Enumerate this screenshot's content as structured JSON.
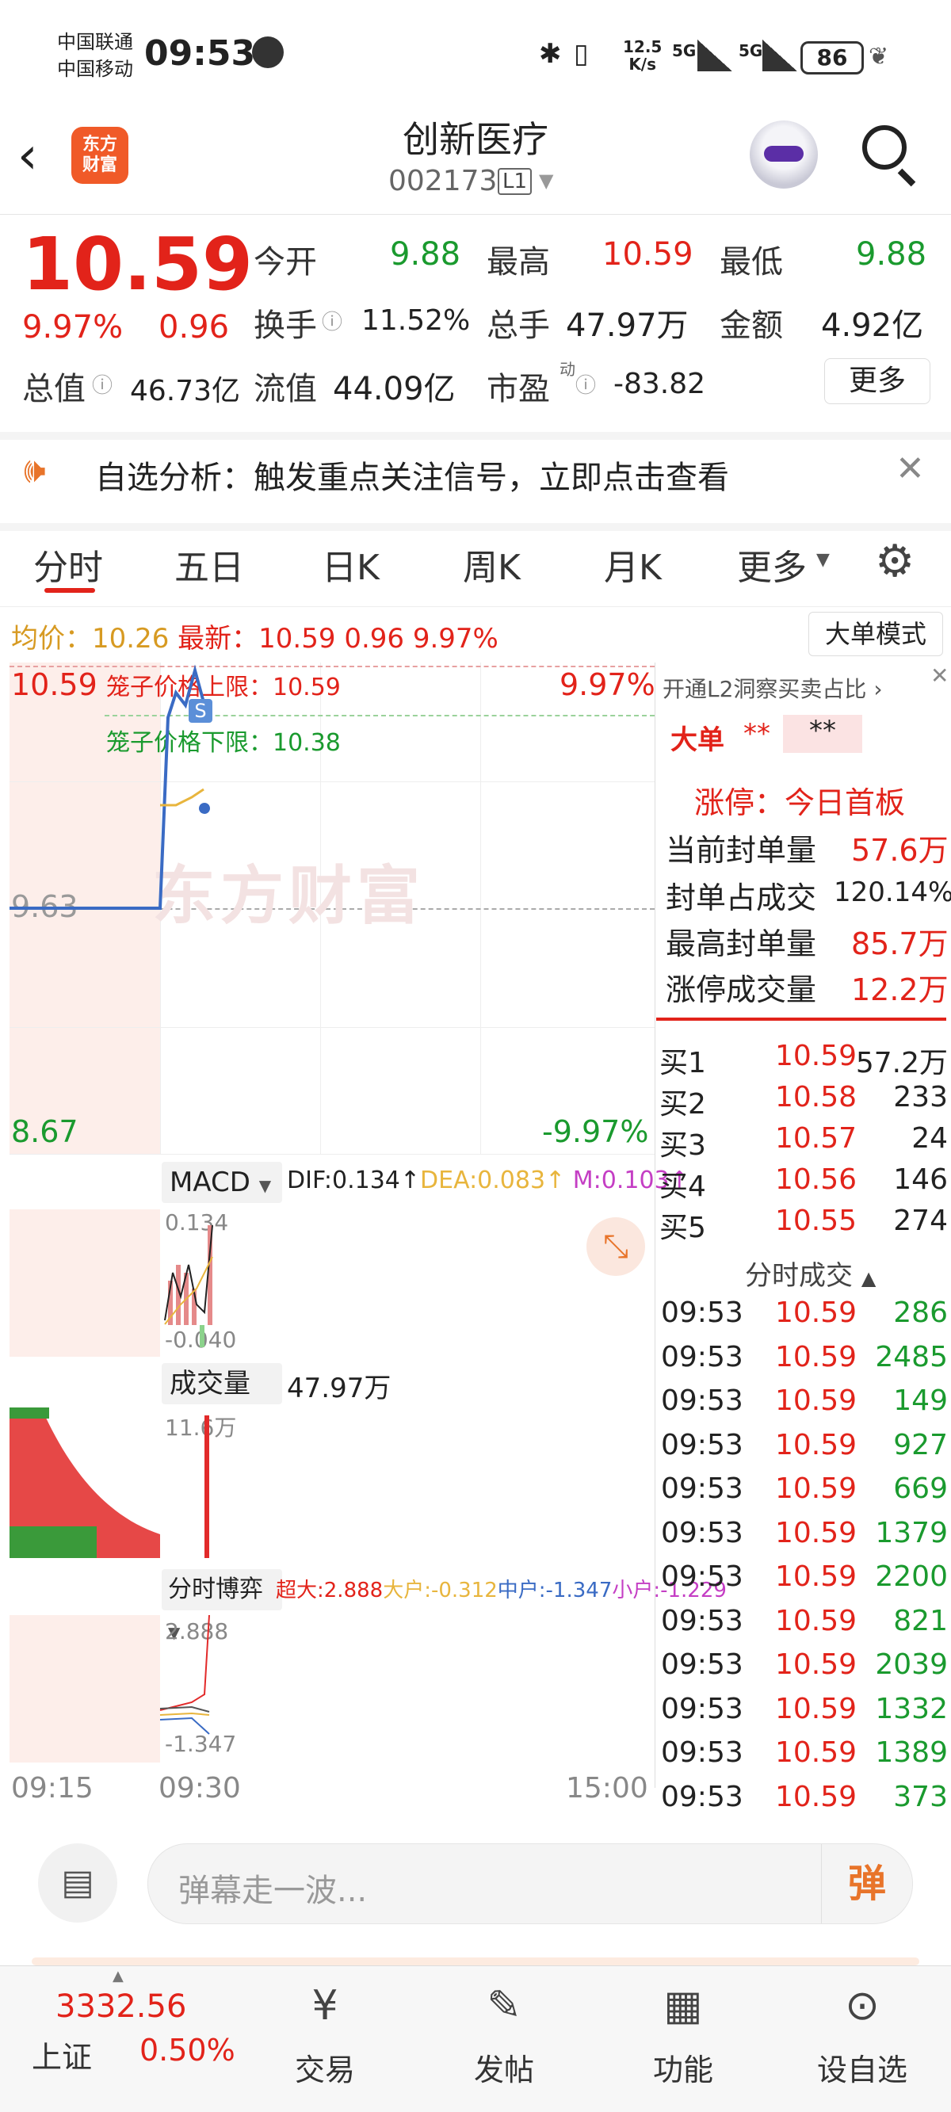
{
  "status_bar": {
    "carrier1": "中国联通",
    "carrier2": "中国移动",
    "time": "09:53",
    "net_speed_top": "12.5",
    "net_speed_bottom": "K/s",
    "sig1": "5G",
    "sig2": "5G",
    "battery": "86"
  },
  "header": {
    "back_icon": "chevron-left-icon",
    "logo_line1": "东方",
    "logo_line2": "财富",
    "title": "创新医疗",
    "code": "002173",
    "level": "L1",
    "search_icon": "search-icon",
    "robot_icon": "robot-assistant-icon"
  },
  "quote": {
    "price": "10.59",
    "change_pct": "9.97%",
    "change": "0.96",
    "open_label": "今开",
    "open": "9.88",
    "high_label": "最高",
    "high": "10.59",
    "low_label": "最低",
    "low": "9.88",
    "turnover_label": "换手",
    "turnover": "11.52%",
    "volume_label": "总手",
    "volume": "47.97万",
    "amount_label": "金额",
    "amount": "4.92亿",
    "mktcap_label": "总值",
    "mktcap": "46.73亿",
    "float_label": "流值",
    "float": "44.09亿",
    "pe_label": "市盈",
    "pe_sup": "动",
    "pe": "-83.82",
    "more_label": "更多"
  },
  "banner": {
    "text": "自选分析：触发重点关注信号，立即点击查看"
  },
  "tabs": [
    "分时",
    "五日",
    "日K",
    "周K",
    "月K",
    "更多"
  ],
  "info_line": {
    "avg_label": "均价：",
    "avg": "10.26",
    "latest_label": "最新：",
    "latest": "10.59",
    "chg": "0.96",
    "pct": "9.97%",
    "mode_button": "大单模式"
  },
  "chart": {
    "y_top": "10.59",
    "y_mid": "9.63",
    "y_bot": "8.67",
    "pct_top": "9.97%",
    "pct_bot": "-9.97%",
    "cage_upper": "笼子价格上限：10.59",
    "cage_lower": "笼子价格下限：10.38",
    "watermark": "东方财富",
    "s_marker": "S",
    "macd_label": "MACD",
    "dif": "DIF:0.134↑",
    "dea": "DEA:0.083↑",
    "m": "M:0.103↑",
    "macd_top": "0.134",
    "macd_bot": "-0.040",
    "vol_label": "成交量",
    "vol_value": "47.97万",
    "vol_top": "11.6万",
    "game_label": "分时博弈",
    "super": "超大:2.888",
    "big": "大户:-0.312",
    "mid": "中户:-1.347",
    "small": "小户:-1.229",
    "game_top": "2.888",
    "game_bot": "-1.347",
    "t_start": "09:15",
    "t_open": "09:30",
    "t_end": "15:00"
  },
  "chart_data": {
    "type": "line",
    "x": [
      "09:15",
      "09:20",
      "09:25",
      "09:30",
      "09:31",
      "09:32",
      "09:33",
      "09:34",
      "09:35"
    ],
    "series": [
      {
        "values": [
          9.63,
          9.63,
          9.63,
          9.63,
          10.4,
          10.5,
          10.45,
          10.59,
          10.45
        ]
      }
    ],
    "ylim": [
      8.67,
      10.59
    ]
  },
  "side": {
    "l2_title": "开通L2洞察买卖占比",
    "big_order_label": "大单",
    "big_order_val1": "**",
    "big_order_val2": "**",
    "limit_title": "涨停：今日首板",
    "seal_qty_label": "当前封单量",
    "seal_qty": "57.6万",
    "seal_ratio_label": "封单占成交",
    "seal_ratio": "120.14%",
    "max_seal_label": "最高封单量",
    "max_seal": "85.7万",
    "limit_vol_label": "涨停成交量",
    "limit_vol": "12.2万",
    "bids": [
      {
        "label": "买1",
        "price": "10.59",
        "qty": "57.2万"
      },
      {
        "label": "买2",
        "price": "10.58",
        "qty": "233"
      },
      {
        "label": "买3",
        "price": "10.57",
        "qty": "24"
      },
      {
        "label": "买4",
        "price": "10.56",
        "qty": "146"
      },
      {
        "label": "买5",
        "price": "10.55",
        "qty": "274"
      }
    ],
    "trades_title": "分时成交",
    "trades": [
      {
        "time": "09:53",
        "price": "10.59",
        "qty": "286"
      },
      {
        "time": "09:53",
        "price": "10.59",
        "qty": "2485"
      },
      {
        "time": "09:53",
        "price": "10.59",
        "qty": "149"
      },
      {
        "time": "09:53",
        "price": "10.59",
        "qty": "927"
      },
      {
        "time": "09:53",
        "price": "10.59",
        "qty": "669"
      },
      {
        "time": "09:53",
        "price": "10.59",
        "qty": "1379"
      },
      {
        "time": "09:53",
        "price": "10.59",
        "qty": "2200"
      },
      {
        "time": "09:53",
        "price": "10.59",
        "qty": "821"
      },
      {
        "time": "09:53",
        "price": "10.59",
        "qty": "2039"
      },
      {
        "time": "09:53",
        "price": "10.59",
        "qty": "1332"
      },
      {
        "time": "09:53",
        "price": "10.59",
        "qty": "1389"
      },
      {
        "time": "09:53",
        "price": "10.59",
        "qty": "373"
      }
    ]
  },
  "comment": {
    "placeholder": "弹幕走一波...",
    "send_label": "弹"
  },
  "bottom_nav": {
    "index_value": "3332.56",
    "index_name": "上证",
    "index_pct": "0.50%",
    "items": [
      "交易",
      "发帖",
      "功能",
      "设自选"
    ]
  }
}
